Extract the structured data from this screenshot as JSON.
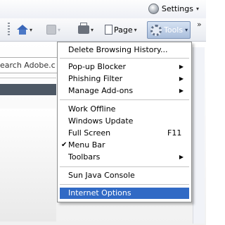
{
  "topbar": {
    "settings_label": "Settings",
    "settings_caret": "▾"
  },
  "toolbar": {
    "page_label": "Page",
    "tools_label": "Tools",
    "caret": "▾",
    "more_chevron": "»"
  },
  "content": {
    "search_text": "earch Adobe.c"
  },
  "tools_menu": {
    "items": [
      {
        "label": "Delete Browsing History..."
      },
      {
        "label": "Pop-up Blocker",
        "arrow": "▶"
      },
      {
        "label": "Phishing Filter",
        "arrow": "▶"
      },
      {
        "label": "Manage Add-ons",
        "arrow": "▶"
      },
      {
        "label": "Work Offline"
      },
      {
        "label": "Windows Update"
      },
      {
        "label": "Full Screen",
        "shortcut": "F11"
      },
      {
        "label": "Menu Bar",
        "check": "✔"
      },
      {
        "label": "Toolbars",
        "arrow": "▶"
      },
      {
        "label": "Sun Java Console"
      },
      {
        "label": "Internet Options",
        "selected": true
      }
    ]
  }
}
